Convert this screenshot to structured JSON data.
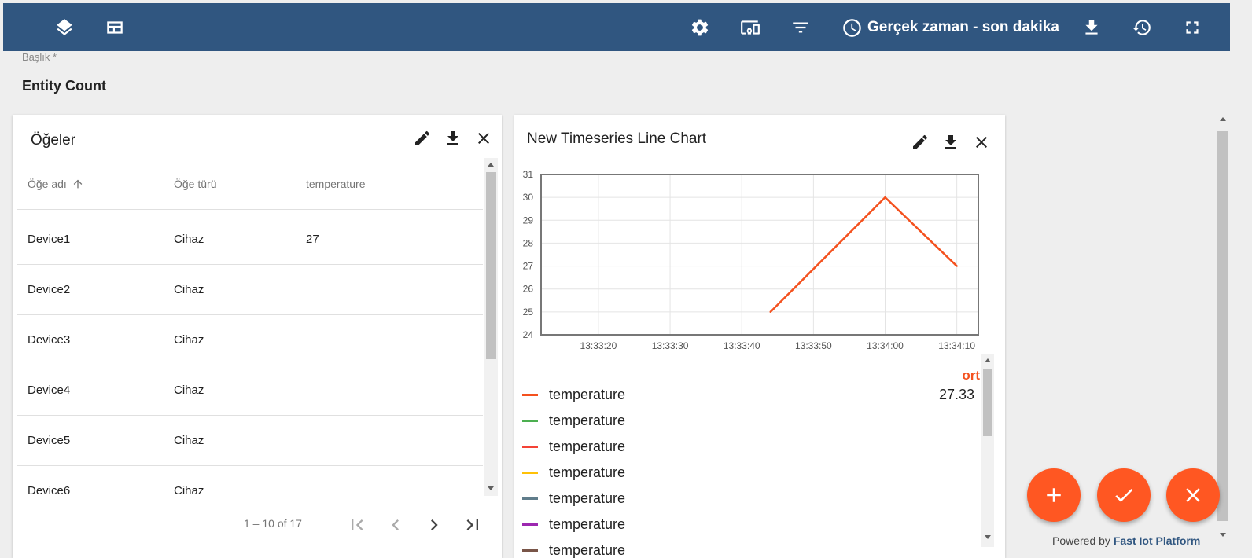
{
  "toolbar": {
    "left_icons": [
      "layers-icon",
      "dashboard-layout-icon"
    ],
    "right_icons": [
      "settings-icon",
      "devices-icon",
      "filter-icon"
    ],
    "timewindow_label": "Gerçek zaman - son dakika",
    "end_icons": [
      "download-icon",
      "history-icon",
      "fullscreen-icon"
    ],
    "background": "#305680"
  },
  "dashboard": {
    "title_label": "Başlık *",
    "title_value": "Entity Count"
  },
  "entities_widget": {
    "title": "Öğeler",
    "columns": [
      "Öğe adı",
      "Öğe türü",
      "temperature"
    ],
    "sort_icon": "arrow-up-icon",
    "rows": [
      [
        "Device1",
        "Cihaz",
        "27"
      ],
      [
        "Device2",
        "Cihaz",
        ""
      ],
      [
        "Device3",
        "Cihaz",
        ""
      ],
      [
        "Device4",
        "Cihaz",
        ""
      ],
      [
        "Device5",
        "Cihaz",
        ""
      ],
      [
        "Device6",
        "Cihaz",
        ""
      ]
    ],
    "paginator": {
      "range": "1 – 10 of 17"
    }
  },
  "chart_widget": {
    "title": "New Timeseries Line Chart",
    "legend_header": "ort",
    "legend": [
      {
        "label": "temperature",
        "color": "#f4511e",
        "value": "27.33"
      },
      {
        "label": "temperature",
        "color": "#4caf50",
        "value": ""
      },
      {
        "label": "temperature",
        "color": "#f44336",
        "value": ""
      },
      {
        "label": "temperature",
        "color": "#ffc107",
        "value": ""
      },
      {
        "label": "temperature",
        "color": "#607d8b",
        "value": ""
      },
      {
        "label": "temperature",
        "color": "#9c27b0",
        "value": ""
      },
      {
        "label": "temperature",
        "color": "#795548",
        "value": ""
      }
    ]
  },
  "chart_data": {
    "type": "line",
    "title": "New Timeseries Line Chart",
    "xlabel": "",
    "ylabel": "",
    "x_ticks": [
      "13:33:20",
      "13:33:30",
      "13:33:40",
      "13:33:50",
      "13:34:00",
      "13:34:10"
    ],
    "y_ticks": [
      24,
      25,
      26,
      27,
      28,
      29,
      30,
      31
    ],
    "xlim": [
      "13:33:12",
      "13:34:13"
    ],
    "ylim": [
      24,
      31
    ],
    "grid": true,
    "series": [
      {
        "name": "temperature",
        "color": "#f4511e",
        "x": [
          "13:33:44",
          "13:34:00",
          "13:34:10"
        ],
        "y": [
          25,
          30,
          27
        ]
      }
    ]
  },
  "fabs": [
    "add-icon",
    "check-icon",
    "close-icon"
  ],
  "footer": {
    "powered_prefix": "Powered by",
    "powered_link": "Fast Iot Platform"
  }
}
